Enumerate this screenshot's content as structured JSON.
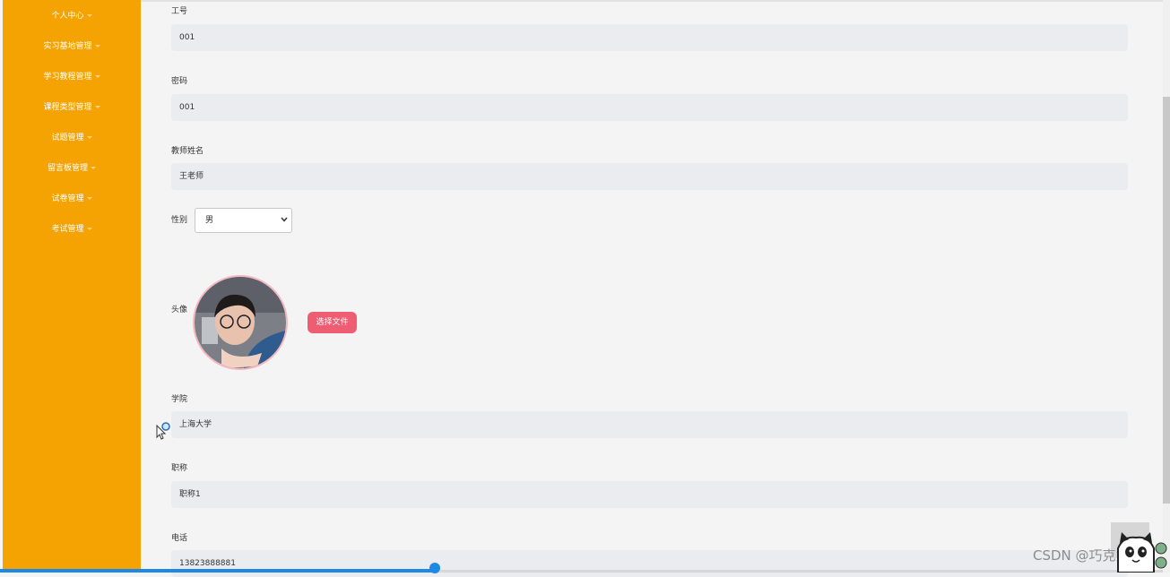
{
  "sidebar": {
    "items": [
      {
        "label": "个人中心"
      },
      {
        "label": "实习基地管理"
      },
      {
        "label": "学习教程管理"
      },
      {
        "label": "课程类型管理"
      },
      {
        "label": "试题管理"
      },
      {
        "label": "留言板管理"
      },
      {
        "label": "试卷管理"
      },
      {
        "label": "考试管理"
      }
    ]
  },
  "form": {
    "employee_id": {
      "label": "工号",
      "value": "001"
    },
    "password": {
      "label": "密码",
      "value": "001"
    },
    "teacher_name": {
      "label": "教师姓名",
      "value": "王老师"
    },
    "gender": {
      "label": "性别",
      "selected": "男"
    },
    "avatar": {
      "label": "头像",
      "button": "选择文件"
    },
    "college": {
      "label": "学院",
      "value": "上海大学"
    },
    "title": {
      "label": "职称",
      "value": "职称1"
    },
    "phone": {
      "label": "电话",
      "value": "13823888881"
    }
  },
  "watermark": "CSDN @巧克力",
  "colors": {
    "sidebar": "#f5a302",
    "button": "#ef5d72",
    "input_bg": "#eaecf0",
    "progress": "#1e88e5"
  }
}
